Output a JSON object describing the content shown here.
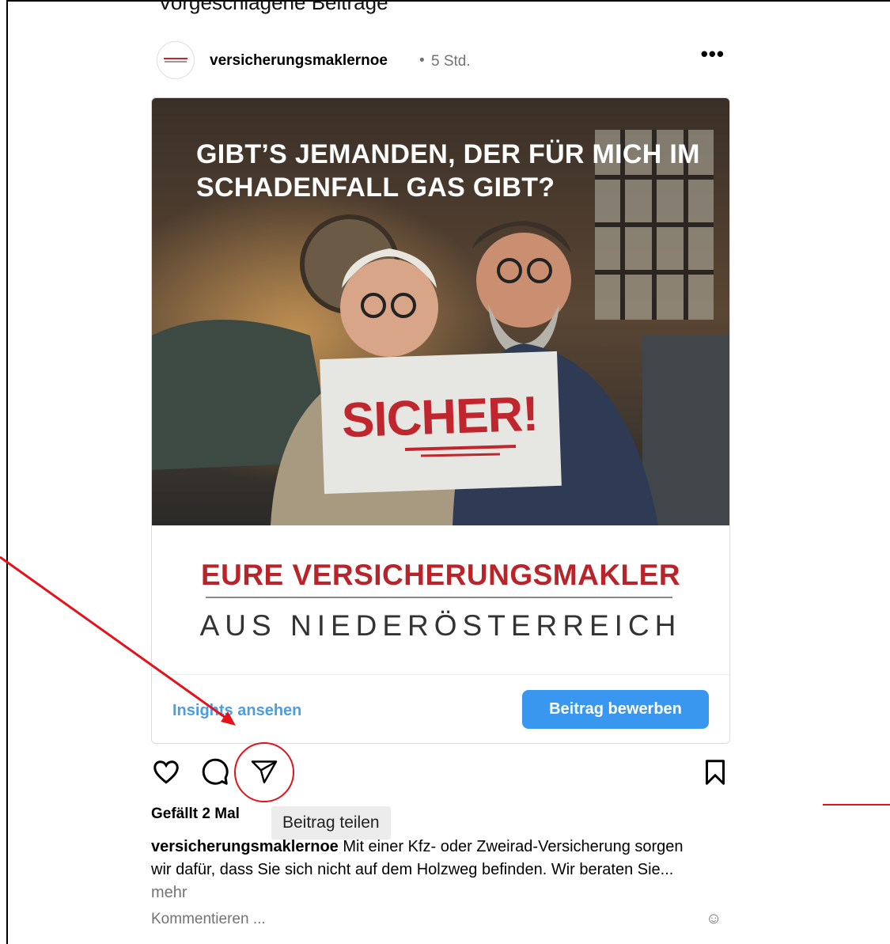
{
  "section": {
    "title": "Vorgeschlagene Beiträge"
  },
  "post": {
    "username": "versicherungsmaklernoe",
    "separator": "•",
    "time": "5 Std.",
    "more": "•••",
    "image": {
      "headline": "GIBT’S JEMANDEN, DER FÜR MICH IM SCHADENFALL GAS GIBT?",
      "sign_text": "SICHER!",
      "banner_line1": "EURE VERSICHERUNGSMAKLER",
      "banner_line2": "AUS NIEDERÖSTERREICH"
    },
    "insights_label": "Insights ansehen",
    "promote_label": "Beitrag bewerben",
    "likes": "Gefällt 2 Mal",
    "share_tooltip": "Beitrag teilen",
    "caption_user": "versicherungsmaklernoe",
    "caption_text": " Mit einer Kfz- oder Zweirad-Versicherung sorgen wir dafür, dass Sie sich nicht auf dem Holzweg befinden. Wir beraten Sie...",
    "caption_more": "mehr",
    "comment_placeholder": "Kommentieren ...",
    "emoji_icon": "☺"
  },
  "icons": {
    "like": "heart-icon",
    "comment": "speech-bubble-icon",
    "share": "paper-plane-icon",
    "save": "bookmark-icon"
  },
  "colors": {
    "accent_blue": "#3a97f0",
    "link_blue": "#4a9de6",
    "annotation_red": "#e3131b",
    "brand_red": "#b9242b"
  }
}
